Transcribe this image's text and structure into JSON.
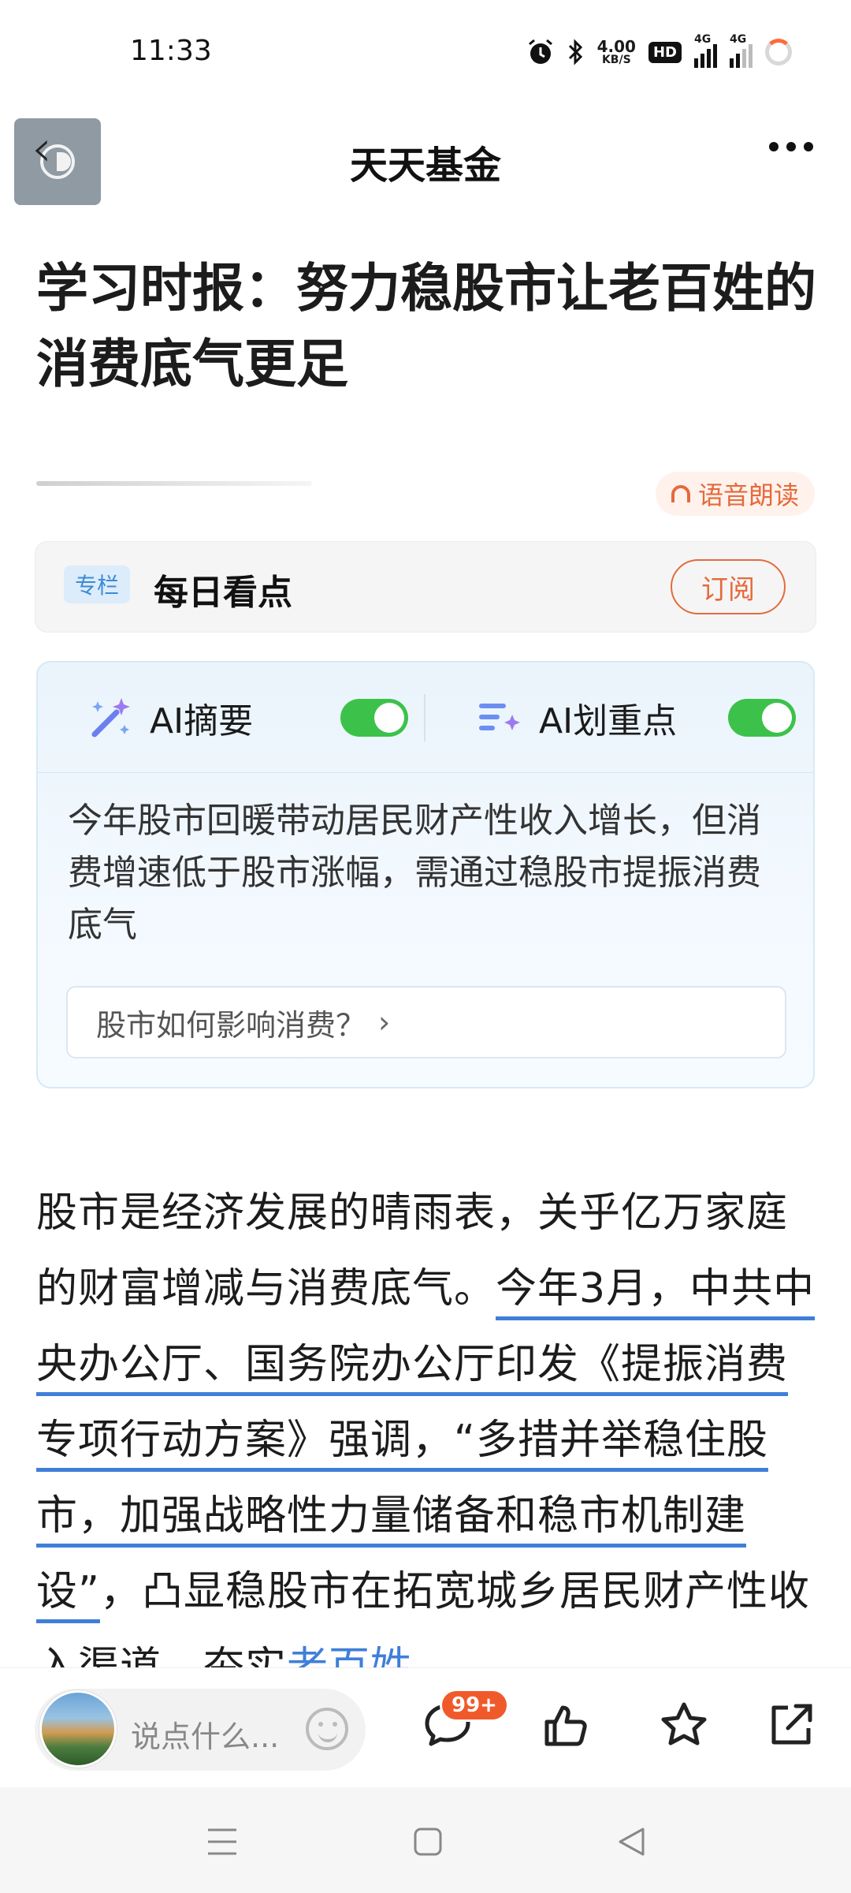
{
  "status_bar": {
    "time": "11:33",
    "net_speed_value": "4.00",
    "net_speed_unit": "KB/S",
    "hd_label": "HD",
    "network_label_1": "4G",
    "network_label_2": "4G"
  },
  "topbar": {
    "title": "天天基金"
  },
  "article": {
    "title": "学习时报：努力稳股市让老百姓的消费底气更足",
    "voice_label": "语音朗读"
  },
  "column": {
    "tag": "专栏",
    "name": "每日看点",
    "subscribe_label": "订阅"
  },
  "ai": {
    "summary_label": "AI摘要",
    "highlight_label": "AI划重点",
    "summary_enabled": true,
    "highlight_enabled": true,
    "summary_text": "今年股市回暖带动居民财产性收入增长，但消费增速低于股市涨幅，需通过稳股市提振消费底气",
    "question": "股市如何影响消费？"
  },
  "body": {
    "part1": "股市是经济发展的晴雨表，关乎亿万家庭的财富增减与消费底气。",
    "highlight": "今年3月，中共中央办公厅、国务院办公厅印发《提振消费专项行动方案》强调，“多措并举稳住股市，加强战略性力量储备和稳市机制建设”",
    "part2": "，凸显稳股市在拓宽城乡居民财产性收入渠道，夯实",
    "link": "老百姓"
  },
  "action_bar": {
    "comment_placeholder": "说点什么...",
    "comment_badge": "99+"
  },
  "colors": {
    "accent_orange": "#e56a3c",
    "link_blue": "#3f7fd8",
    "toggle_green": "#3cc24a"
  }
}
